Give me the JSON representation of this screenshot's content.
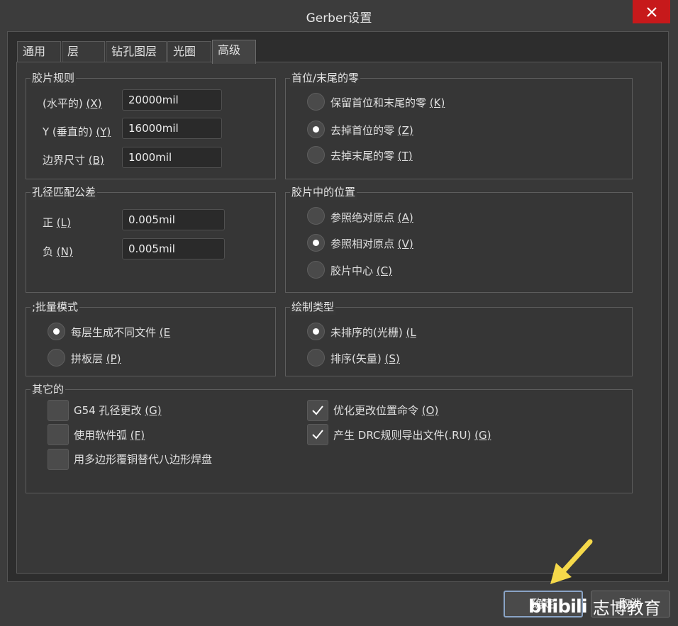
{
  "window": {
    "title": "Gerber设置"
  },
  "tabs": [
    "通用",
    "层",
    "钻孔图层",
    "光圈",
    "高级"
  ],
  "film": {
    "title": "胶片规则",
    "x_label": "(水平的) ",
    "x_key": "(X)",
    "x_value": "20000mil",
    "y_label": "Y (垂直的) ",
    "y_key": "(Y)",
    "y_value": "16000mil",
    "border_label": "边界尺寸 ",
    "border_key": "(B)",
    "border_value": "1000mil"
  },
  "zeros": {
    "title": "首位/末尾的零",
    "options": [
      {
        "label": "保留首位和末尾的零 ",
        "key": "(K)",
        "selected": false
      },
      {
        "label": "去掉首位的零 ",
        "key": "(Z)",
        "selected": true
      },
      {
        "label": "去掉末尾的零 ",
        "key": "(T)",
        "selected": false
      }
    ]
  },
  "tolerance": {
    "title": "孔径匹配公差",
    "plus_label": "正 ",
    "plus_key": "(L)",
    "plus_value": "0.005mil",
    "minus_label": "负 ",
    "minus_key": "(N)",
    "minus_value": "0.005mil"
  },
  "position": {
    "title": "胶片中的位置",
    "options": [
      {
        "label": "参照绝对原点 ",
        "key": "(A)",
        "selected": false
      },
      {
        "label": "参照相对原点 ",
        "key": "(V)",
        "selected": true
      },
      {
        "label": "胶片中心 ",
        "key": "(C)",
        "selected": false
      }
    ]
  },
  "batch": {
    "title": ";批量模式",
    "options": [
      {
        "label": "每层生成不同文件 ",
        "key": "(E",
        "selected": true
      },
      {
        "label": "拼板层 ",
        "key": "(P)",
        "selected": false
      }
    ]
  },
  "plot": {
    "title": "绘制类型",
    "options": [
      {
        "label": "未排序的(光栅) ",
        "key": "(L",
        "selected": true
      },
      {
        "label": "排序(矢量) ",
        "key": "(S)",
        "selected": false
      }
    ]
  },
  "other": {
    "title": "其它的",
    "checks": [
      {
        "label": "G54 孔径更改 ",
        "key": "(G)",
        "checked": false
      },
      {
        "label": "使用软件弧 ",
        "key": "(F)",
        "checked": false
      },
      {
        "label": "用多边形覆铜替代八边形焊盘",
        "key": "",
        "checked": false
      },
      {
        "label": "优化更改位置命令 ",
        "key": "(O)",
        "checked": true
      },
      {
        "label": "产生 DRC规则导出文件(.RU) ",
        "key": "(G)",
        "checked": true
      }
    ]
  },
  "buttons": {
    "ok": "确定",
    "cancel": "取消"
  },
  "watermark": {
    "logo": "bilibili",
    "text": "志博教育"
  },
  "colors": {
    "close": "#c7191b",
    "arrow": "#f5d94a",
    "ok_border": "#8aa4c6"
  }
}
